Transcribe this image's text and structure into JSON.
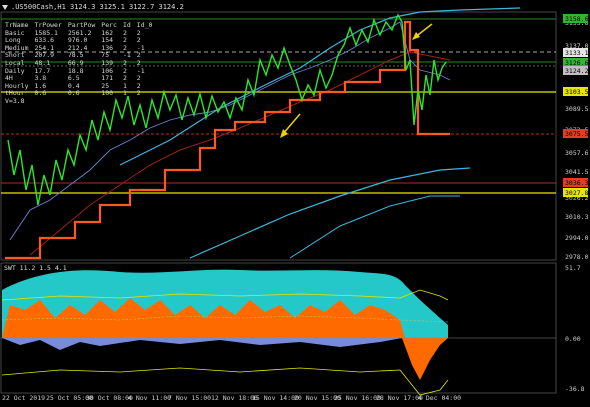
{
  "window": {
    "symbol_line": ".US500Cash,H1  3124.3 3125.1 3122.7 3124.2"
  },
  "stats_table": {
    "headers": [
      "TrName",
      "TrPower",
      "PartPow",
      "Perc",
      "Id",
      "Id_0"
    ],
    "rows": [
      [
        "Basic",
        "1585.1",
        "2561.2",
        "162",
        "2",
        "2"
      ],
      [
        "Long",
        "633.6",
        "976.0",
        "154",
        "2",
        "2"
      ],
      [
        "Medium",
        "254.1",
        "212.4",
        "136",
        "2",
        "-1"
      ],
      [
        "Short",
        "207.9",
        "78.5",
        "75",
        "-1",
        "2"
      ],
      [
        "Local",
        "48.1",
        "66.9",
        "139",
        "2",
        "2"
      ],
      [
        "Daily",
        "17.7",
        "18.8",
        "106",
        "2",
        "-1"
      ],
      [
        "4H",
        "3.8",
        "6.5",
        "171",
        "2",
        "2"
      ],
      [
        "Hourly",
        "1.6",
        "0.4",
        "25",
        "1",
        "2"
      ],
      [
        "tHour",
        "0.6",
        "0.6",
        "100",
        "1",
        "2"
      ]
    ],
    "footer": "V=3.8"
  },
  "price_axis": {
    "labels": [
      "3153.6",
      "3137.0",
      "3121.6",
      "3105.2",
      "3089.5",
      "3073.5",
      "3057.6",
      "3041.5",
      "3026.2",
      "3010.3",
      "2994.0",
      "2978.0"
    ]
  },
  "price_tags": [
    {
      "text": "3158.6",
      "bg": "#2fb82f",
      "fg": "#000"
    },
    {
      "text": "3133.1",
      "bg": "#e6e6e6",
      "fg": "#000"
    },
    {
      "text": "3126.6",
      "bg": "#2fb82f",
      "fg": "#000"
    },
    {
      "text": "3124.2",
      "bg": "#c0c0c0",
      "fg": "#000"
    },
    {
      "text": "3103.5",
      "bg": "#e6e600",
      "fg": "#000"
    },
    {
      "text": "3075.5",
      "bg": "#e04020",
      "fg": "#000"
    },
    {
      "text": "3036.3",
      "bg": "#e04020",
      "fg": "#000"
    },
    {
      "text": "3027.8",
      "bg": "#e6e600",
      "fg": "#000"
    }
  ],
  "sub_window": {
    "title": "SWT 11.2 1.5 4.1",
    "axis_labels": [
      "51.7",
      "0.00",
      "-36.8"
    ]
  },
  "x_axis": {
    "labels": [
      "22 Oct 2019",
      "25 Oct 05:00",
      "30 Oct 08:00",
      "4 Nov 11:00",
      "7 Nov 15:00",
      "12 Nov 18:00",
      "15 Nov 14:00",
      "20 Nov 15:00",
      "25 Nov 16:00",
      "28 Nov 17:00",
      "4 Dec 04:00"
    ]
  },
  "colors": {
    "candles": "#2ee62e",
    "stop_line": "#ff5a1e",
    "channel": "#3fb6d9",
    "blue_line": "#6a82d8",
    "yellow": "#e6e600",
    "cyan_fill": "#25c8c8",
    "orange_fill": "#ff6a00",
    "arrow": "#f0d000"
  }
}
